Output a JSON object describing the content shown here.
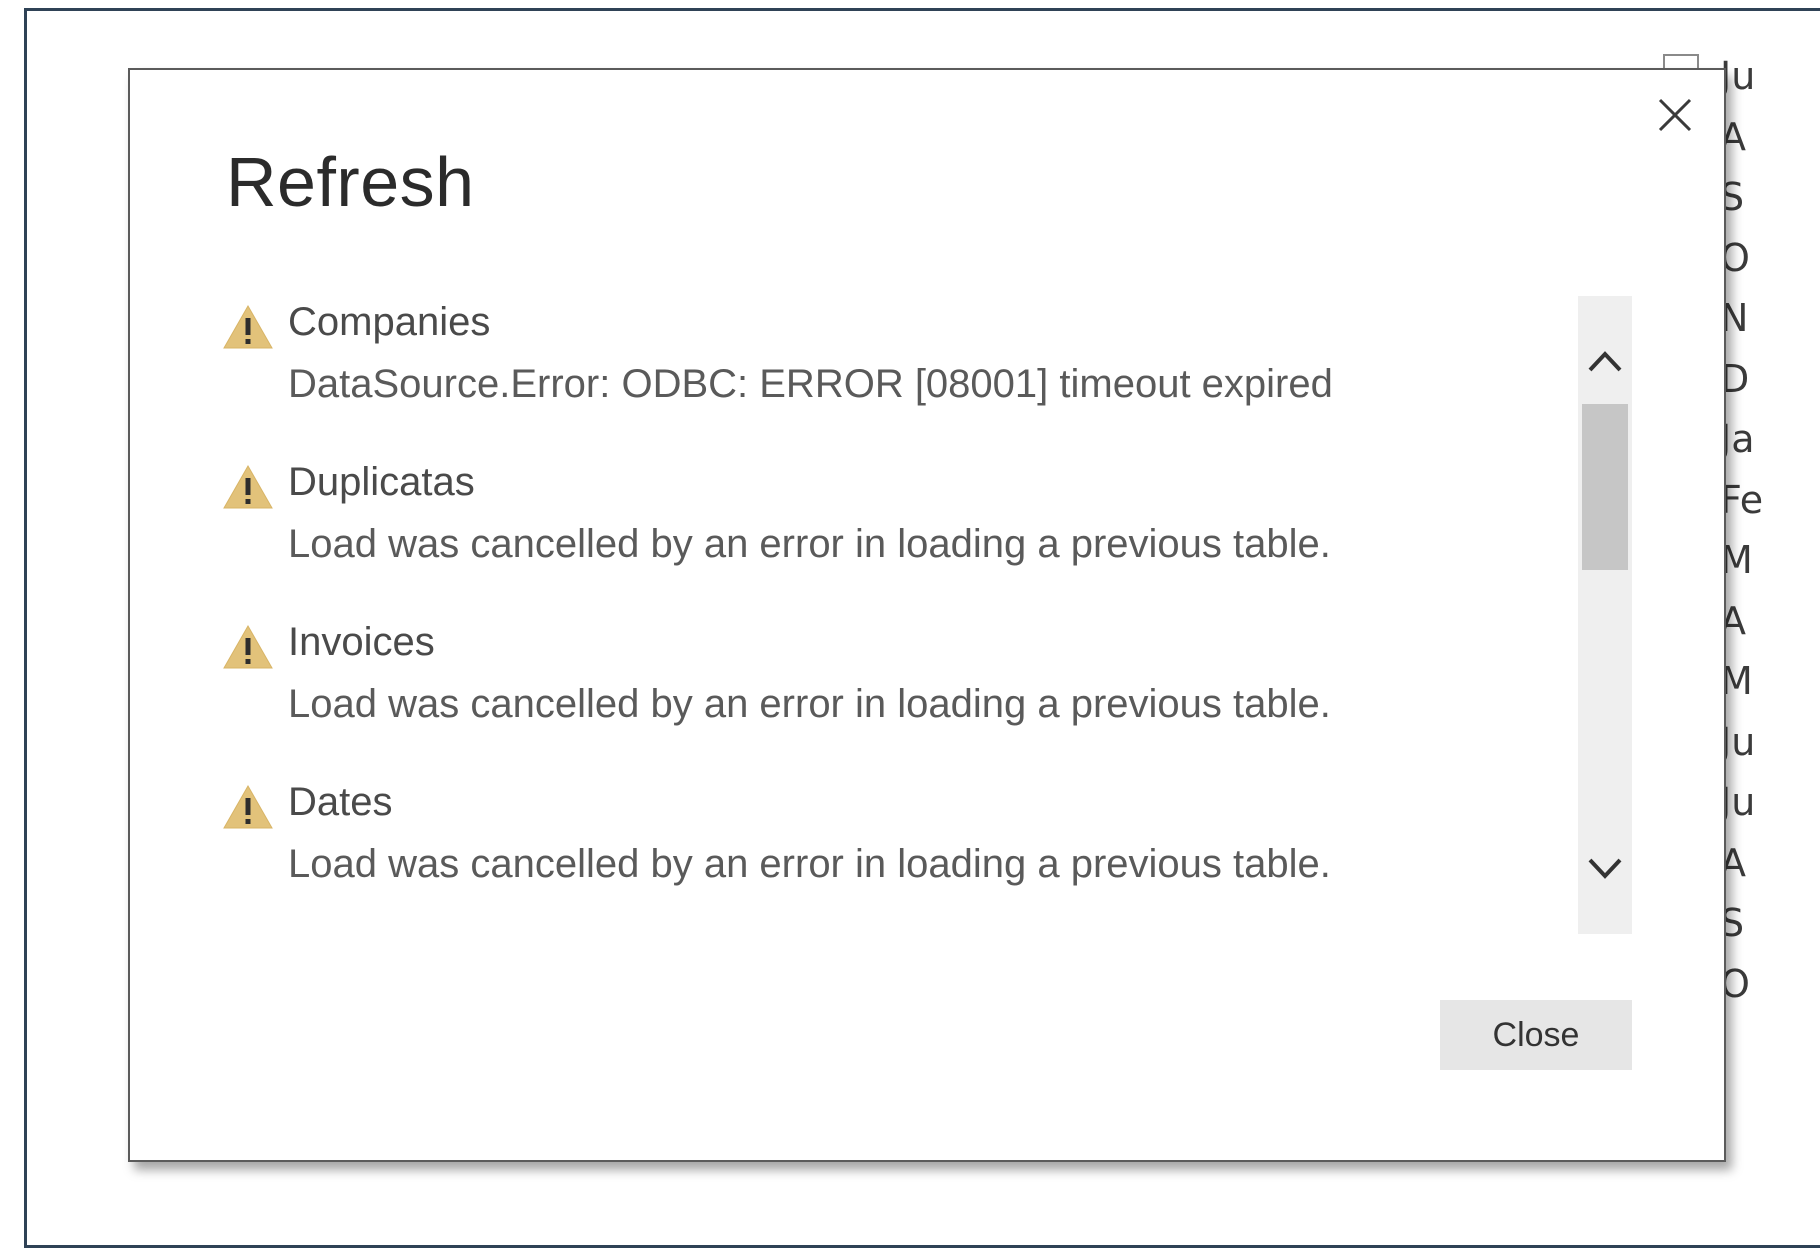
{
  "dialog": {
    "title": "Refresh",
    "close_icon": "close-icon",
    "errors": [
      {
        "icon": "warning-icon",
        "table": "Companies",
        "message": "DataSource.Error: ODBC: ERROR [08001] timeout expired"
      },
      {
        "icon": "warning-icon",
        "table": "Duplicatas",
        "message": "Load was cancelled by an error in loading a previous table."
      },
      {
        "icon": "warning-icon",
        "table": "Invoices",
        "message": "Load was cancelled by an error in loading a previous table."
      },
      {
        "icon": "warning-icon",
        "table": "Dates",
        "message": "Load was cancelled by an error in loading a previous table."
      }
    ],
    "close_button_label": "Close"
  },
  "colors": {
    "warning": "#e2c27a",
    "frame": "#2f4256",
    "button_bg": "#e6e6e6",
    "scroll_track": "#efefef",
    "scroll_thumb": "#c6c6c6"
  },
  "background": {
    "month_list": [
      "Ju",
      "A",
      "S",
      "O",
      "N",
      "D",
      "Ja",
      "Fe",
      "M",
      "A",
      "M",
      "Ju",
      "Ju",
      "A",
      "S",
      "O"
    ]
  }
}
